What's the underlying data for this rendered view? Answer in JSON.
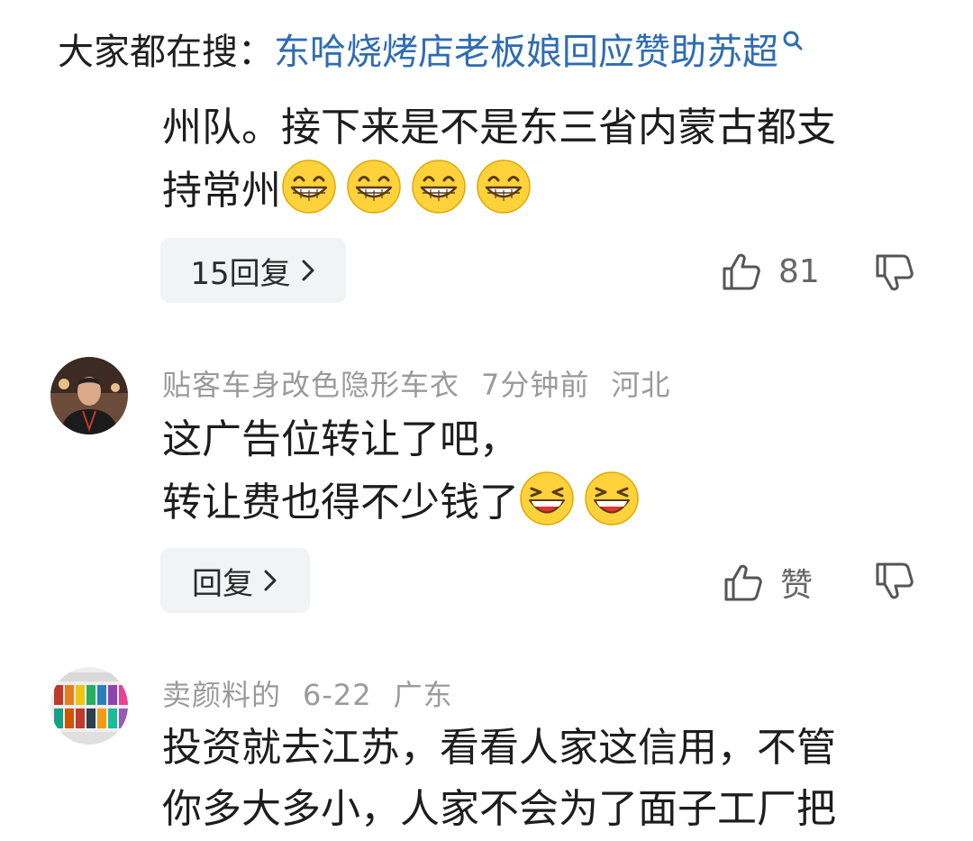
{
  "search": {
    "prefix": "大家都在搜：",
    "query": "东哈烧烤店老板娘回应赞助苏超"
  },
  "comments": [
    {
      "text_lines": [
        "州队。接下来是不是东三省内蒙古都支",
        "持常州"
      ],
      "emoji_count": 4,
      "emoji_name": "grin-emoji",
      "reply_label": "15回复",
      "like_label": "81"
    },
    {
      "author": "贴客车身改色隐形车衣",
      "time": "7分钟前",
      "location": "河北",
      "text_lines": [
        "这广告位转让了吧，",
        "转让费也得不少钱了"
      ],
      "emoji_count": 2,
      "emoji_name": "laugh-emoji",
      "reply_label": "回复",
      "like_label": "赞"
    },
    {
      "author": "卖颜料的",
      "time": "6-22",
      "location": "广东",
      "text_lines": [
        "投资就去江苏，看看人家这信用，不管",
        "你多大多小，人家不会为了面子工厂把"
      ]
    }
  ],
  "colors": {
    "link": "#2f6cb3",
    "meta": "#9a9a9a",
    "button_bg": "#f2f3f5",
    "emoji_yellow": "#ffd23c"
  }
}
